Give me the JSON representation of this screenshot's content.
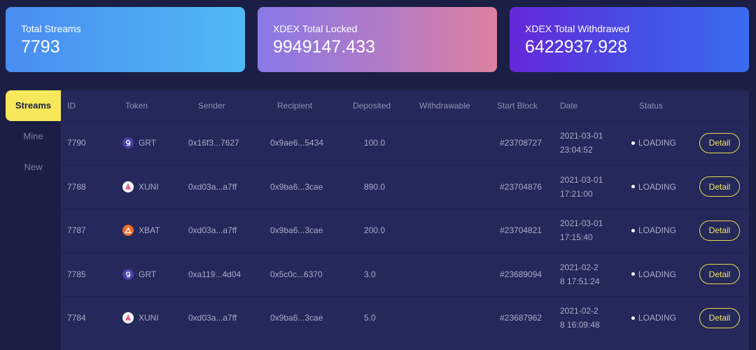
{
  "cards": [
    {
      "label": "Total Streams",
      "value": "7793"
    },
    {
      "label": "XDEX Total Locked",
      "value": "9949147.433"
    },
    {
      "label": "XDEX Total Withdrawed",
      "value": "6422937.928"
    }
  ],
  "sidebar": {
    "items": [
      {
        "label": "Streams",
        "active": true
      },
      {
        "label": "Mine",
        "active": false
      },
      {
        "label": "New",
        "active": false
      }
    ]
  },
  "table": {
    "headers": [
      "ID",
      "Token",
      "Sender",
      "Recipient",
      "Deposited",
      "Withdrawable",
      "Start Block",
      "Date",
      "Status"
    ],
    "rows": [
      {
        "id": "7790",
        "token": "GRT",
        "token_icon": "grt-icon",
        "sender": "0x16f3...7627",
        "recipient": "0x9ae6...5434",
        "deposited": "100.0",
        "withdrawable": "",
        "start_block": "#23708727",
        "date_line1": "2021-03-01",
        "date_line2": "23:04:52",
        "status": "LOADING",
        "action": "Detail"
      },
      {
        "id": "7788",
        "token": "XUNI",
        "token_icon": "xuni-icon",
        "sender": "0xd03a...a7ff",
        "recipient": "0x9ba6...3cae",
        "deposited": "890.0",
        "withdrawable": "",
        "start_block": "#23704876",
        "date_line1": "2021-03-01",
        "date_line2": "17:21:00",
        "status": "LOADING",
        "action": "Detail"
      },
      {
        "id": "7787",
        "token": "XBAT",
        "token_icon": "xbat-icon",
        "sender": "0xd03a...a7ff",
        "recipient": "0x9ba6...3cae",
        "deposited": "200.0",
        "withdrawable": "",
        "start_block": "#23704821",
        "date_line1": "2021-03-01",
        "date_line2": "17:15:40",
        "status": "LOADING",
        "action": "Detail"
      },
      {
        "id": "7785",
        "token": "GRT",
        "token_icon": "grt-icon",
        "sender": "0xa119...4d04",
        "recipient": "0x5c0c...6370",
        "deposited": "3.0",
        "withdrawable": "",
        "start_block": "#23689094",
        "date_line1": "2021-02-2",
        "date_line2": "8 17:51:24",
        "status": "LOADING",
        "action": "Detail"
      },
      {
        "id": "7784",
        "token": "XUNI",
        "token_icon": "xuni-icon",
        "sender": "0xd03a...a7ff",
        "recipient": "0x9ba6...3cae",
        "deposited": "5.0",
        "withdrawable": "",
        "start_block": "#23687962",
        "date_line1": "2021-02-2",
        "date_line2": "8 16:09:48",
        "status": "LOADING",
        "action": "Detail"
      }
    ]
  },
  "colors": {
    "accent_yellow": "#f6e85a",
    "background": "#1b1f45",
    "table_bg": "#24285a",
    "grt": "#4c3ea8",
    "xuni": "#ffffff",
    "xbat": "#ee6a2a"
  }
}
